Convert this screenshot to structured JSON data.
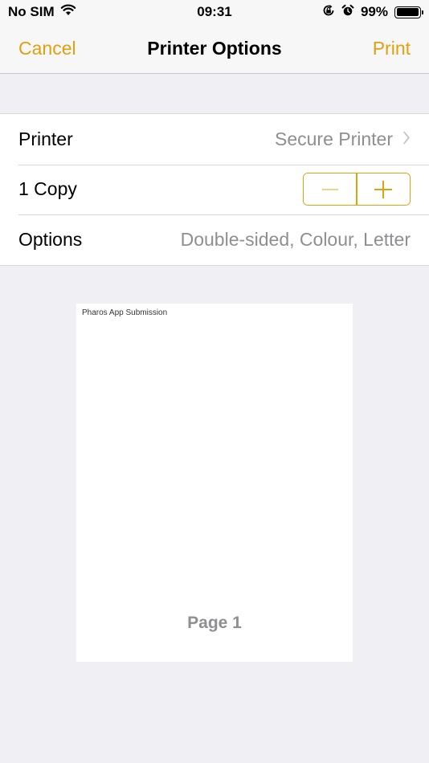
{
  "status_bar": {
    "carrier": "No SIM",
    "time": "09:31",
    "battery_percent": "99%",
    "battery_level": 0.99,
    "icons": [
      "wifi-icon",
      "orientation-lock-icon",
      "alarm-icon",
      "battery-icon"
    ]
  },
  "nav": {
    "cancel_label": "Cancel",
    "title": "Printer Options",
    "print_label": "Print"
  },
  "rows": {
    "printer": {
      "label": "Printer",
      "value": "Secure Printer"
    },
    "copies": {
      "label": "1 Copy"
    },
    "options": {
      "label": "Options",
      "value": "Double-sided, Colour, Letter"
    }
  },
  "preview": {
    "header_text": "Pharos App Submission",
    "page_label": "Page 1"
  },
  "colors": {
    "accent": "#e0a10f",
    "background": "#efeff4",
    "secondary_text": "#8e8e93"
  }
}
